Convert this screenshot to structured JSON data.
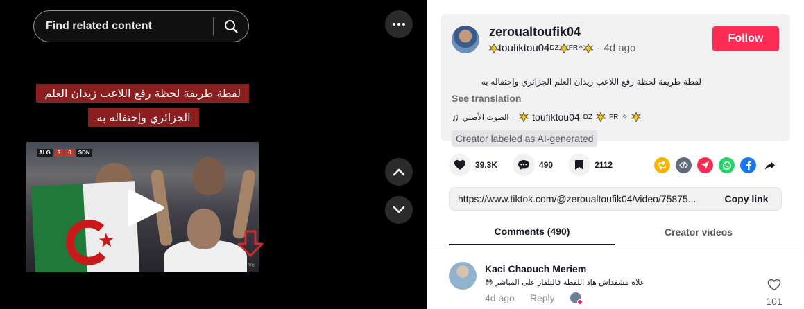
{
  "video": {
    "search_placeholder": "Find related content",
    "caption": "لقطة طريفة لحظة رفع اللاعب زيدان العلم الجزائري وإحتفاله به",
    "scorebug": {
      "home": "ALG",
      "home_score": "3",
      "away_score": "0",
      "away": "SDN"
    },
    "watermark": "Ve"
  },
  "post": {
    "username": "zeroualtoufik04",
    "nickname": "toufiktou04",
    "nickname_tag_1": "DZ",
    "nickname_tag_2": "FR",
    "separator": "·",
    "date": "4d ago",
    "follow_label": "Follow",
    "description": "لقطة طريفة لحظة رفع اللاعب زيدان العلم الجزائري وإحتفاله به",
    "see_translation": "See translation",
    "sound_note": "♫",
    "sound_original": "الصوت الأصلي",
    "sound_dash": "-",
    "ai_label": "Creator labeled as AI-generated"
  },
  "stats": {
    "likes": "39.3K",
    "comments": "490",
    "saves": "2112"
  },
  "share_colors": {
    "repost": "#f7b500",
    "embed": "#5f6b7a",
    "send": "#fe2c55",
    "whatsapp": "#25d366",
    "facebook": "#1877f2"
  },
  "link": {
    "url": "https://www.tiktok.com/@zeroualtoufik04/video/75875...",
    "copy_label": "Copy link"
  },
  "tabs": {
    "comments": "Comments (490)",
    "creator": "Creator videos"
  },
  "comment": {
    "name": "Kaci Chaouch Meriem",
    "text": "علاه مشفداش هاذ اللقطة فالتلفاز على المباشر",
    "emoji": "😳",
    "date": "4d ago",
    "reply": "Reply",
    "likes": "101"
  }
}
